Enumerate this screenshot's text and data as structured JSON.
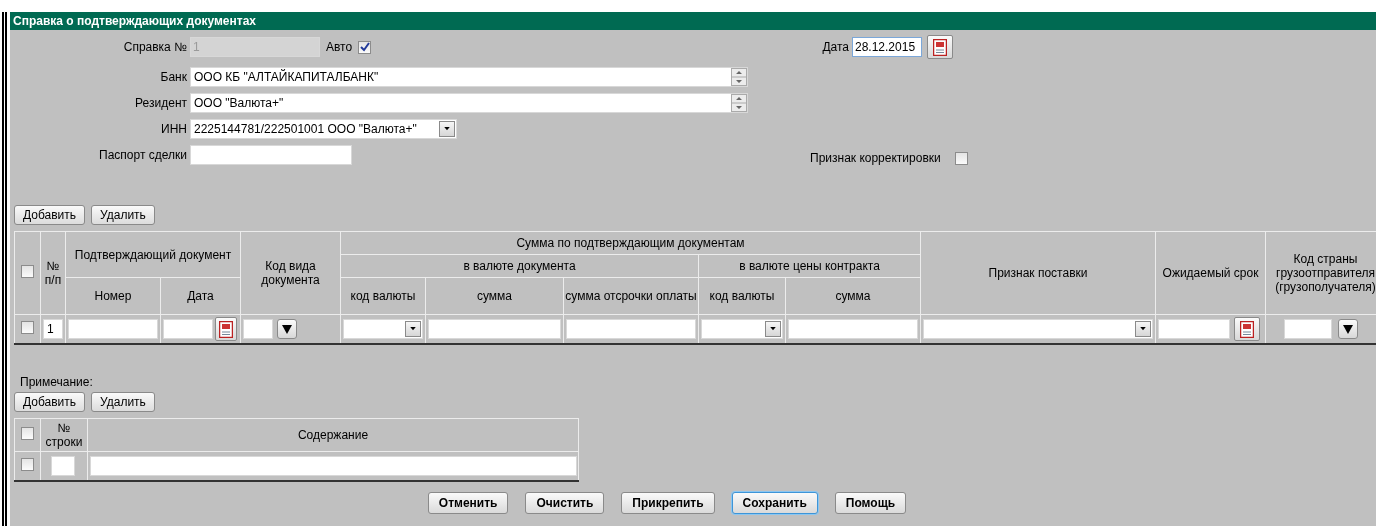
{
  "window": {
    "title": "Справка о подтверждающих документах"
  },
  "form": {
    "certificate_number": {
      "label": "Справка №",
      "value": "1",
      "disabled": true
    },
    "auto": {
      "label": "Авто",
      "checked": true
    },
    "date": {
      "label": "Дата",
      "value": "28.12.2015"
    },
    "bank": {
      "label": "Банк",
      "value": "ООО КБ \"АЛТАЙКАПИТАЛБАНК\""
    },
    "resident": {
      "label": "Резидент",
      "value": "ООО \"Валюта+\""
    },
    "inn": {
      "label": "ИНН",
      "value": "2225144781/222501001 ООО \"Валюта+\""
    },
    "deal_passport": {
      "label": "Паспорт сделки"
    },
    "correction_flag": {
      "label": "Признак корректировки",
      "checked": false
    }
  },
  "documents": {
    "buttons": [
      "Добавить",
      "Удалить"
    ],
    "header_checked": false,
    "columns": {
      "number": "№ п/п",
      "document": "Подтверждающий документ",
      "doc_number": "Номер",
      "doc_date": "Дата",
      "doc_kind": "Код вида документа",
      "sum": "Сумма по подтверждающим документам",
      "in_doc_currency": "в валюте документа",
      "currency_code_1": "код валюты",
      "amount_1": "сумма",
      "deferred": "сумма отсрочки оплаты",
      "in_contract_currency": "в валюте цены контракта",
      "currency_code_2": "код валюты",
      "amount_2": "сумма",
      "delivery": "Признак поставки",
      "expected": "Ожидаемый срок",
      "country": "Код страны грузоотправителя (грузополучателя)"
    },
    "rows": [
      {
        "checked": false,
        "number": "1"
      }
    ]
  },
  "note": {
    "label": "Примечание:",
    "buttons": [
      "Добавить",
      "Удалить"
    ],
    "header_checked": false,
    "columns": [
      "№ строки",
      "Содержание"
    ],
    "rows": [
      {
        "checked": false
      }
    ]
  },
  "buttons": [
    {
      "label": "Отменить",
      "focused": false
    },
    {
      "label": "Очистить",
      "focused": false
    },
    {
      "label": "Прикрепить",
      "focused": false
    },
    {
      "label": "Сохранить",
      "focused": true
    },
    {
      "label": "Помощь",
      "focused": false
    }
  ]
}
